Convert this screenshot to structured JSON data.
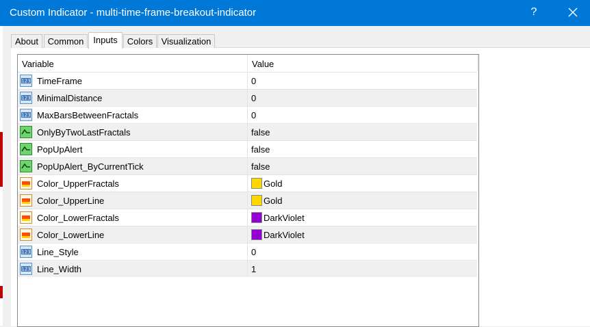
{
  "window": {
    "title": "Custom Indicator - multi-time-frame-breakout-indicator",
    "help": "?"
  },
  "tabs": [
    {
      "label": "About"
    },
    {
      "label": "Common"
    },
    {
      "label": "Inputs",
      "active": true
    },
    {
      "label": "Colors"
    },
    {
      "label": "Visualization"
    }
  ],
  "grid": {
    "headers": {
      "variable": "Variable",
      "value": "Value"
    },
    "rows": [
      {
        "name": "TimeFrame",
        "value": "0",
        "icon": "number-icon"
      },
      {
        "name": "MinimalDistance",
        "value": "0",
        "icon": "number-icon"
      },
      {
        "name": "MaxBarsBetweenFractals",
        "value": "0",
        "icon": "number-icon"
      },
      {
        "name": "OnlyByTwoLastFractals",
        "value": "false",
        "icon": "boolean-icon"
      },
      {
        "name": "PopUpAlert",
        "value": "false",
        "icon": "boolean-icon"
      },
      {
        "name": "PopUpAlert_ByCurrentTick",
        "value": "false",
        "icon": "boolean-icon"
      },
      {
        "name": "Color_UpperFractals",
        "value": "Gold",
        "icon": "color-icon",
        "swatch": "#ffd700"
      },
      {
        "name": "Color_UpperLine",
        "value": "Gold",
        "icon": "color-icon",
        "swatch": "#ffd700"
      },
      {
        "name": "Color_LowerFractals",
        "value": "DarkViolet",
        "icon": "color-icon",
        "swatch": "#9400d3"
      },
      {
        "name": "Color_LowerLine",
        "value": "DarkViolet",
        "icon": "color-icon",
        "swatch": "#9400d3"
      },
      {
        "name": "Line_Style",
        "value": "0",
        "icon": "number-icon"
      },
      {
        "name": "Line_Width",
        "value": "1",
        "icon": "number-icon"
      }
    ]
  },
  "colors": {
    "titlebar": "#0078d7"
  }
}
